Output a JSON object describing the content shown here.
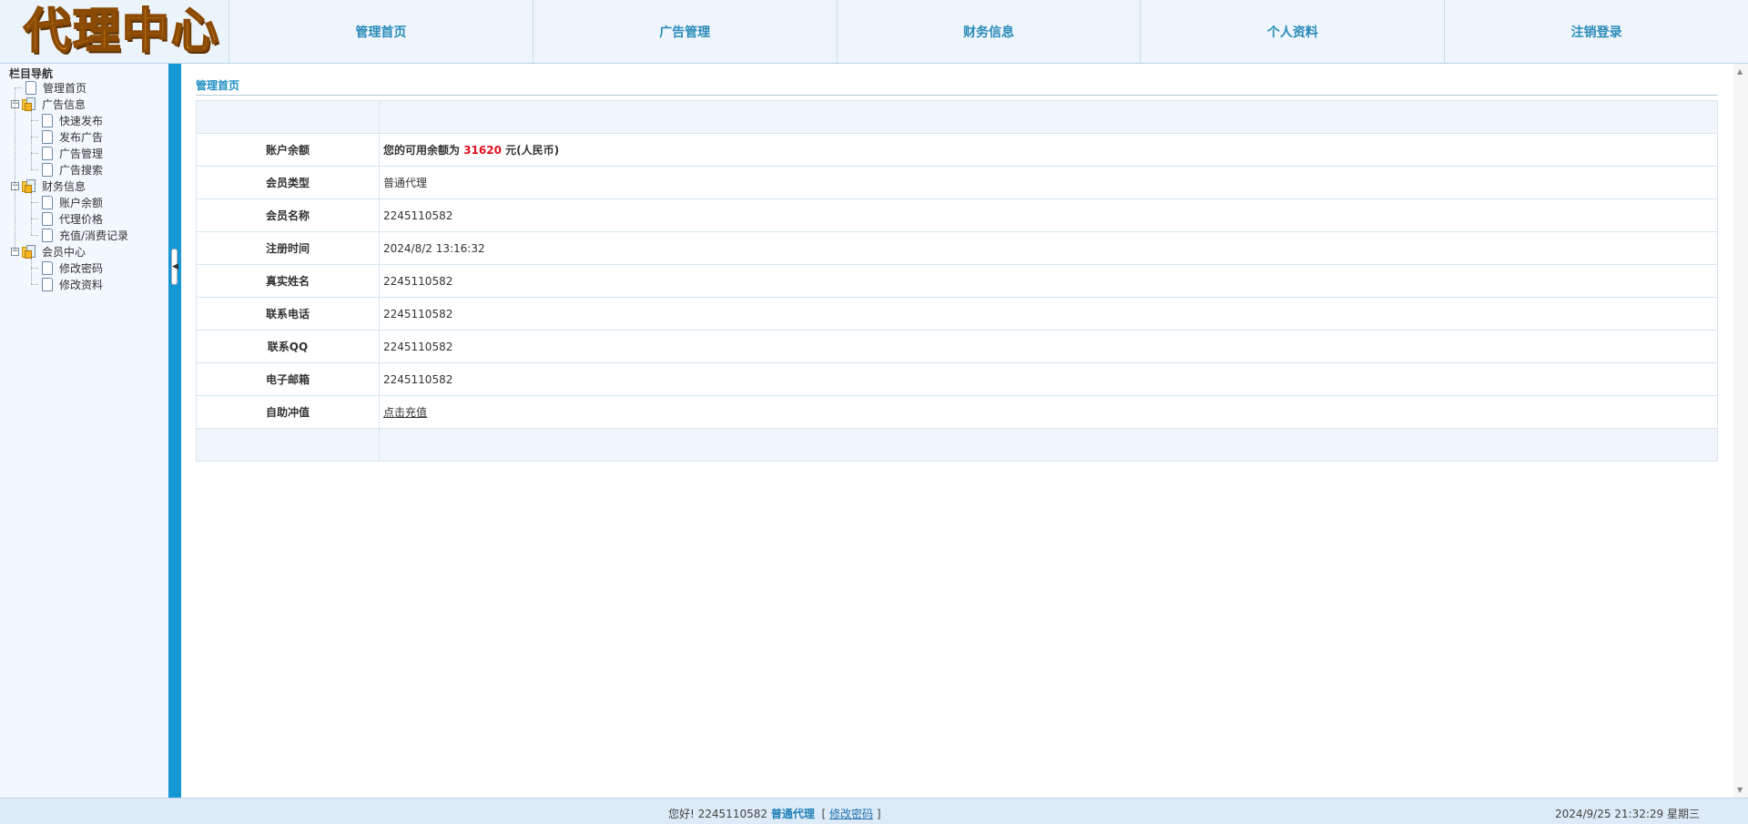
{
  "header": {
    "logo_text": "代理中心",
    "nav": [
      "管理首页",
      "广告管理",
      "财务信息",
      "个人资料",
      "注销登录"
    ]
  },
  "sidebar": {
    "title": "栏目导航",
    "items": [
      {
        "label": "管理首页",
        "type": "doc",
        "level": 0
      },
      {
        "label": "广告信息",
        "type": "folder",
        "level": 0
      },
      {
        "label": "快速发布",
        "type": "doc",
        "level": 1
      },
      {
        "label": "发布广告",
        "type": "doc",
        "level": 1
      },
      {
        "label": "广告管理",
        "type": "doc",
        "level": 1
      },
      {
        "label": "广告搜索",
        "type": "doc",
        "level": 1
      },
      {
        "label": "财务信息",
        "type": "folder",
        "level": 0
      },
      {
        "label": "账户余额",
        "type": "doc",
        "level": 1
      },
      {
        "label": "代理价格",
        "type": "doc",
        "level": 1
      },
      {
        "label": "充值/消费记录",
        "type": "doc",
        "level": 1
      },
      {
        "label": "会员中心",
        "type": "folder",
        "level": 0
      },
      {
        "label": "修改密码",
        "type": "doc",
        "level": 1
      },
      {
        "label": "修改资料",
        "type": "doc",
        "level": 1
      }
    ]
  },
  "main": {
    "title": "管理首页",
    "balance": {
      "label": "账户余额",
      "prefix": "您的可用余额为",
      "amount": "31620",
      "suffix": "元(人民币)"
    },
    "rows": [
      {
        "label": "会员类型",
        "value": "普通代理"
      },
      {
        "label": "会员名称",
        "value": "2245110582"
      },
      {
        "label": "注册时间",
        "value": "2024/8/2 13:16:32"
      },
      {
        "label": "真实姓名",
        "value": "2245110582"
      },
      {
        "label": "联系电话",
        "value": "2245110582"
      },
      {
        "label": "联系QQ",
        "value": "2245110582"
      },
      {
        "label": "电子邮箱",
        "value": "2245110582"
      }
    ],
    "recharge": {
      "label": "自助冲值",
      "link": "点击充值"
    }
  },
  "footer": {
    "greeting": "您好!",
    "username": "2245110582",
    "role": "普通代理",
    "bracket_open": "[",
    "change_password": "修改密码",
    "bracket_close": "]",
    "datetime": "2024/9/25 21:32:29 星期三"
  }
}
